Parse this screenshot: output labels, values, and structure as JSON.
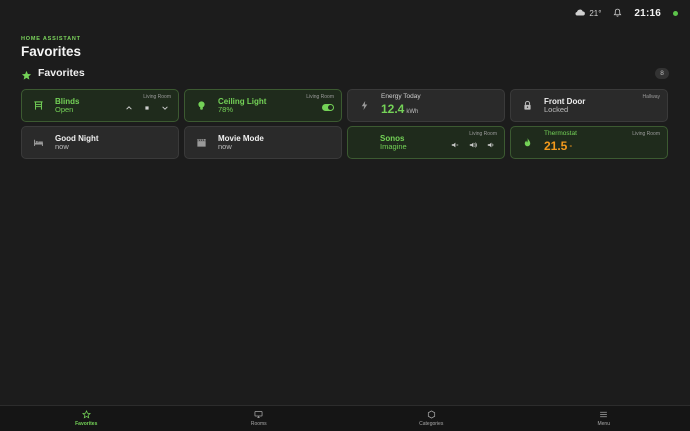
{
  "status_bar": {
    "weather_icon": "cloud-icon",
    "temperature": "21°",
    "time": "21:16"
  },
  "header": {
    "app_label": "HOME ASSISTANT",
    "title": "Favorites"
  },
  "section": {
    "title": "Favorites",
    "count": "8",
    "icon": "star-icon"
  },
  "colors": {
    "accent": "#74d257",
    "orange": "#f39a1c",
    "background": "#1c1c1c",
    "card": "#2a2a2a",
    "card_on": "#1f2b1c"
  },
  "cards": [
    {
      "name": "Blinds",
      "state": "Open",
      "room": "Living Room",
      "icon": "blinds-icon"
    },
    {
      "name": "Ceiling Light",
      "state": "78%",
      "room": "Living Room",
      "icon": "lightbulb-icon"
    },
    {
      "name": "Energy Today",
      "value": "12.4",
      "unit": "kWh",
      "icon": "lightning-icon"
    },
    {
      "name": "Front Door",
      "state": "Locked",
      "room": "Hallway",
      "icon": "lock-icon"
    },
    {
      "name": "Good Night",
      "state": "now",
      "icon": "bed-icon"
    },
    {
      "name": "Movie Mode",
      "state": "now",
      "icon": "clapperboard-icon"
    },
    {
      "name": "Sonos",
      "state": "Imagine",
      "room": "Living Room",
      "icon": "speaker-icon"
    },
    {
      "name": "Thermostat",
      "value": "21.5",
      "unit": "°",
      "room": "Living Room",
      "icon": "flame-icon"
    }
  ],
  "nav": [
    {
      "label": "Favorites",
      "icon": "star-icon"
    },
    {
      "label": "Rooms",
      "icon": "monitor-icon"
    },
    {
      "label": "Categories",
      "icon": "hexagon-icon"
    },
    {
      "label": "Menu",
      "icon": "menu-icon"
    }
  ]
}
